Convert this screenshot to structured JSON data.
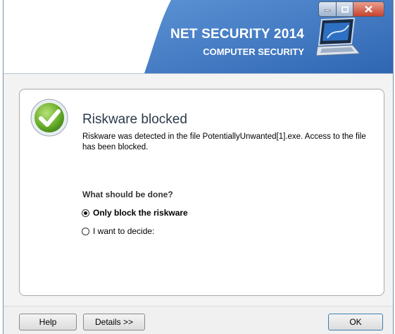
{
  "header": {
    "brand_line1": "NET SECURITY 2014",
    "brand_line2": "COMPUTER SECURITY",
    "brand_color": "#3f78c2",
    "illustration": "laptop-icon"
  },
  "window_controls": {
    "minimize": "minimize-icon",
    "maximize": "maximize-icon",
    "close": "close-icon"
  },
  "alert": {
    "status_icon": "checkmark-icon",
    "title": "Riskware blocked",
    "message": "Riskware was detected in the file PotentiallyUnwanted[1].exe. Access to the file has been blocked.",
    "question": "What should be done?",
    "options": [
      {
        "label": "Only block the riskware",
        "selected": true
      },
      {
        "label": "I want to decide:",
        "selected": false
      }
    ]
  },
  "footer": {
    "help_label": "Help",
    "details_label": "Details >>",
    "ok_label": "OK"
  }
}
